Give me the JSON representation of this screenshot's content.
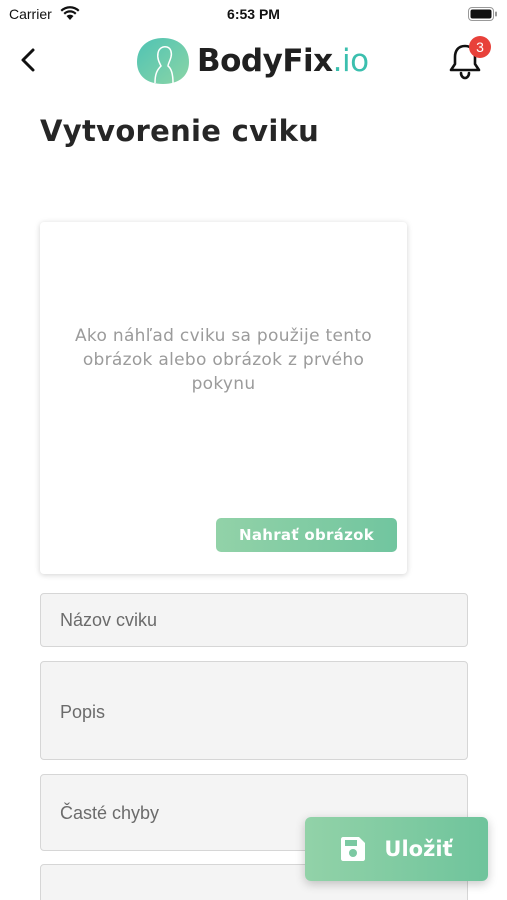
{
  "status_bar": {
    "carrier": "Carrier",
    "time": "6:53 PM"
  },
  "header": {
    "brand_name": "BodyFix",
    "brand_suffix": ".io",
    "notification_count": "3",
    "icons": {
      "back": "chevron-left-icon",
      "notifications": "bell-icon",
      "logo": "bodyfix-logo"
    }
  },
  "page": {
    "title": "Vytvorenie cviku"
  },
  "image_card": {
    "hint": "Ako náhľad cviku sa použije tento obrázok alebo obrázok z prvého pokynu",
    "upload_label": "Nahrať obrázok"
  },
  "form": {
    "name_placeholder": "Názov cviku",
    "description_placeholder": "Popis",
    "mistakes_placeholder": "Časté chyby"
  },
  "save_button": {
    "label": "Uložiť",
    "icon": "floppy-disk-icon"
  },
  "colors": {
    "accent": "#7bc9a2",
    "brand_suffix": "#3bbfae",
    "badge": "#e8413a"
  }
}
